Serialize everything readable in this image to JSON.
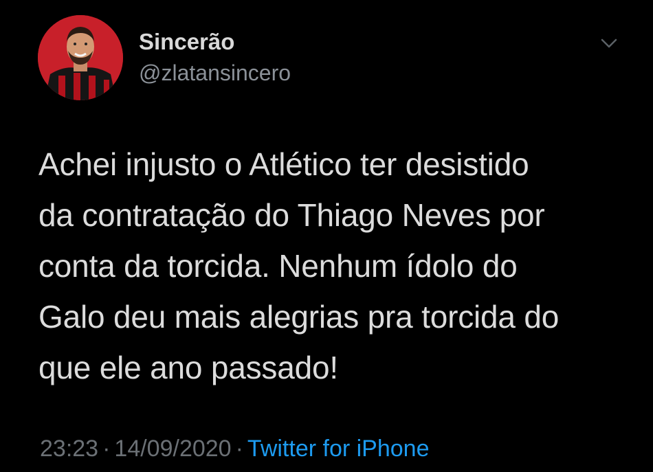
{
  "author": {
    "display_name": "Sincerão",
    "handle": "@zlatansincero",
    "avatar_icon": "profile-photo-avatar"
  },
  "header": {
    "menu_icon": "chevron-down-icon"
  },
  "tweet": {
    "text": "Achei injusto o Atlético ter desistido\nda contratação do Thiago Neves por\nconta da torcida. Nenhum ídolo do\nGalo deu mais alegrias pra torcida do\nque ele ano passado!"
  },
  "meta": {
    "time": "23:23",
    "separator": "·",
    "date": "14/09/2020",
    "source": "Twitter for iPhone"
  },
  "colors": {
    "background": "#000000",
    "text": "#d9d9d9",
    "muted": "#8b9198",
    "link": "#1d9bf0",
    "avatar_bg": "#c8202a"
  }
}
